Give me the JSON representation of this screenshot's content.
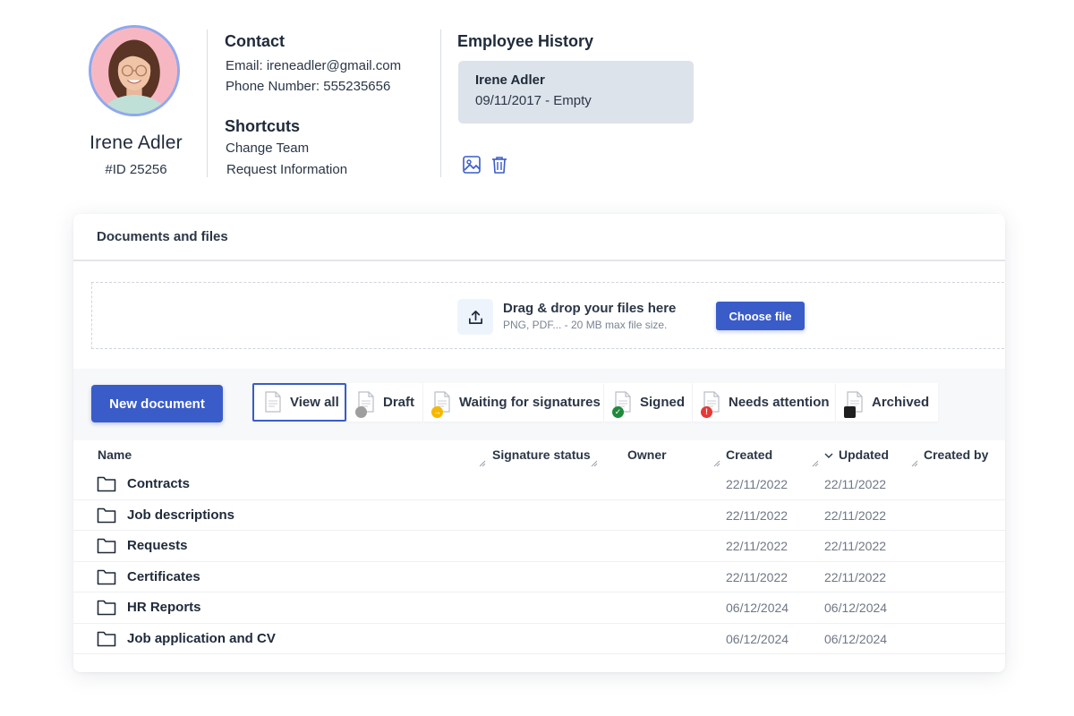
{
  "profile": {
    "name": "Irene Adler",
    "id_label": "#ID 25256"
  },
  "contact": {
    "title": "Contact",
    "email": "Email: ireneadler@gmail.com",
    "phone": "Phone Number: 555235656"
  },
  "shortcuts": {
    "title": "Shortcuts",
    "items": [
      "Change Team",
      "Request Information"
    ]
  },
  "history": {
    "title": "Employee History",
    "entry_name": "Irene Adler",
    "entry_date": "09/11/2017 - Empty",
    "actions": [
      "image-icon",
      "trash-icon"
    ]
  },
  "documents": {
    "title": "Documents and files",
    "upload": {
      "title": "Drag & drop your files here",
      "subtitle": "PNG, PDF... - 20 MB max file size.",
      "button": "Choose file"
    },
    "new_document_label": "New document",
    "filters": [
      {
        "label": "View all",
        "active": true,
        "status": "none"
      },
      {
        "label": "Draft",
        "active": false,
        "status": "draft",
        "color": "#9e9e9e"
      },
      {
        "label": "Waiting for signatures",
        "active": false,
        "status": "waiting",
        "color": "#f5b800"
      },
      {
        "label": "Signed",
        "active": false,
        "status": "signed",
        "color": "#1e8a3a"
      },
      {
        "label": "Needs attention",
        "active": false,
        "status": "attention",
        "color": "#e53935"
      },
      {
        "label": "Archived",
        "active": false,
        "status": "archived",
        "color": "#1f1f1f"
      }
    ],
    "columns": [
      "Name",
      "Signature status",
      "Owner",
      "Created",
      "Updated",
      "Created by"
    ],
    "sort_column": "Updated",
    "rows": [
      {
        "name": "Contracts",
        "created": "22/11/2022",
        "updated": "22/11/2022"
      },
      {
        "name": "Job descriptions",
        "created": "22/11/2022",
        "updated": "22/11/2022"
      },
      {
        "name": "Requests",
        "created": "22/11/2022",
        "updated": "22/11/2022"
      },
      {
        "name": "Certificates",
        "created": "22/11/2022",
        "updated": "22/11/2022"
      },
      {
        "name": "HR Reports",
        "created": "06/12/2024",
        "updated": "06/12/2024"
      },
      {
        "name": "Job application and CV",
        "created": "06/12/2024",
        "updated": "06/12/2024"
      }
    ]
  },
  "colors": {
    "accent": "#3a5cc8",
    "avatar_ring": "#8fa8ee",
    "history_card": "#dde3ea"
  }
}
